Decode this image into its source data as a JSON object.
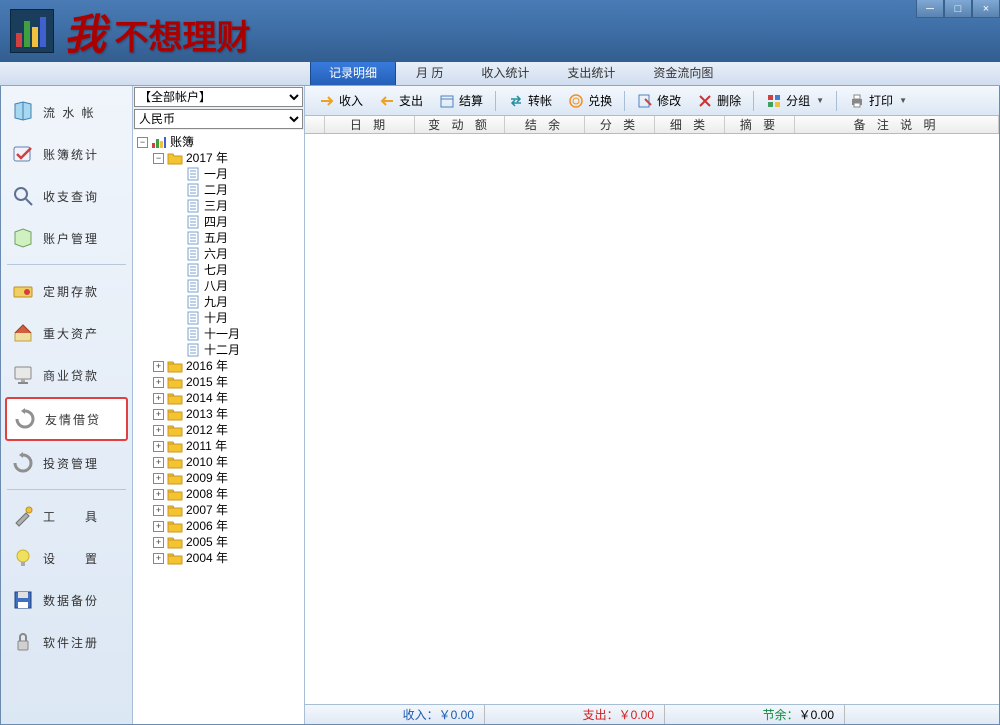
{
  "app": {
    "title": "我 不想理财"
  },
  "tabs": [
    "记录明细",
    "月 历",
    "收入统计",
    "支出统计",
    "资金流向图"
  ],
  "sidebar": {
    "items": [
      {
        "id": "flow",
        "label": "流 水 帐"
      },
      {
        "id": "bookstat",
        "label": "账簿统计"
      },
      {
        "id": "query",
        "label": "收支查询"
      },
      {
        "id": "account",
        "label": "账户管理"
      },
      {
        "id": "deposit",
        "label": "定期存款"
      },
      {
        "id": "asset",
        "label": "重大资产"
      },
      {
        "id": "loan",
        "label": "商业贷款"
      },
      {
        "id": "friend",
        "label": "友情借贷"
      },
      {
        "id": "invest",
        "label": "投资管理"
      },
      {
        "id": "tools",
        "label": "工　　具"
      },
      {
        "id": "settings",
        "label": "设　　置"
      },
      {
        "id": "backup",
        "label": "数据备份"
      },
      {
        "id": "register",
        "label": "软件注册"
      }
    ]
  },
  "combos": {
    "account": "【全部帐户】",
    "currency": "人民币"
  },
  "tree": {
    "root": "账簿",
    "year_open": "2017 年",
    "months": [
      "一月",
      "二月",
      "三月",
      "四月",
      "五月",
      "六月",
      "七月",
      "八月",
      "九月",
      "十月",
      "十一月",
      "十二月"
    ],
    "years_closed": [
      "2016 年",
      "2015 年",
      "2014 年",
      "2013 年",
      "2012 年",
      "2011 年",
      "2010 年",
      "2009 年",
      "2008 年",
      "2007 年",
      "2006 年",
      "2005 年",
      "2004 年"
    ]
  },
  "toolbar": {
    "income": "收入",
    "expense": "支出",
    "settle": "结算",
    "transfer": "转帐",
    "exchange": "兑换",
    "modify": "修改",
    "delete": "删除",
    "group": "分组",
    "print": "打印"
  },
  "grid": {
    "cols": [
      "日 期",
      "变 动 额",
      "结  余",
      "分  类",
      "细  类",
      "摘  要",
      "备 注 说 明"
    ]
  },
  "status": {
    "income_label": "收入：",
    "income_val": "￥0.00",
    "expense_label": "支出：",
    "expense_val": "￥0.00",
    "balance_label": "节余：",
    "balance_val": "￥0.00"
  }
}
